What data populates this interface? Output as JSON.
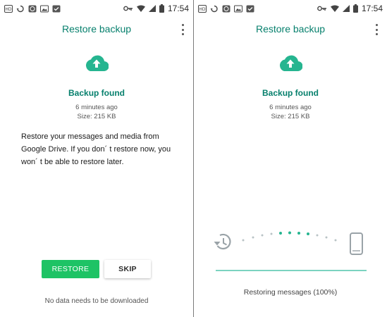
{
  "status_bar": {
    "time": "17:54",
    "icons": [
      "hd-icon",
      "sync-icon",
      "whatsapp-icon",
      "image-icon",
      "check-icon",
      "key-icon",
      "wifi-icon",
      "signal-icon",
      "battery-icon"
    ]
  },
  "colors": {
    "accent": "#07806d",
    "button_green": "#1ec365",
    "cloud": "#26b590",
    "progress": "#7cd3c0"
  },
  "left_screen": {
    "title": "Restore backup",
    "backup_found": "Backup found",
    "backup_time": "6 minutes ago",
    "backup_size": "Size: 215 KB",
    "message": "Restore your messages and media from Google Drive. If you don´ t restore now, you won´ t be able to restore later.",
    "restore_button": "RESTORE",
    "skip_button": "SKIP",
    "footnote": "No data needs to be downloaded"
  },
  "right_screen": {
    "title": "Restore backup",
    "backup_found": "Backup found",
    "backup_time": "6 minutes ago",
    "backup_size": "Size: 215 KB",
    "status": "Restoring messages (100%)",
    "progress_fraction": 1.0
  }
}
